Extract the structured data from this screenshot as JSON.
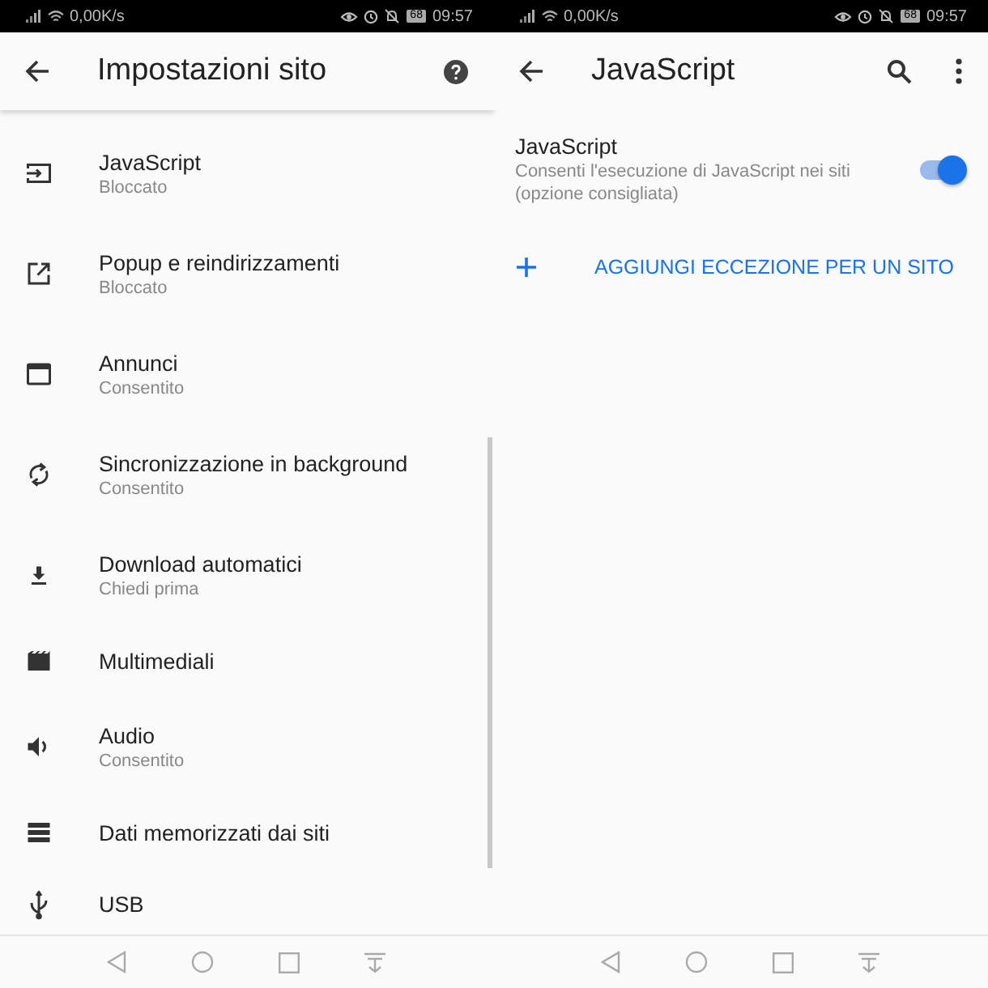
{
  "status_bars": [
    {
      "speed": "0,00K/s",
      "battery": "68",
      "time": "09:57"
    },
    {
      "speed": "0,00K/s",
      "battery": "68",
      "time": "09:57"
    }
  ],
  "site_settings": {
    "title": "Impostazioni sito",
    "items": [
      {
        "kind": "javascript",
        "title": "JavaScript",
        "subtitle": "Bloccato"
      },
      {
        "kind": "popup",
        "title": "Popup e reindirizzamenti",
        "subtitle": "Bloccato"
      },
      {
        "kind": "ads",
        "title": "Annunci",
        "subtitle": "Consentito"
      },
      {
        "kind": "sync",
        "title": "Sincronizzazione in background",
        "subtitle": "Consentito"
      },
      {
        "kind": "download",
        "title": "Download automatici",
        "subtitle": "Chiedi prima"
      },
      {
        "kind": "media",
        "title": "Multimediali"
      },
      {
        "kind": "sound",
        "title": "Audio",
        "subtitle": "Consentito"
      },
      {
        "kind": "storage",
        "title": "Dati memorizzati dai siti"
      },
      {
        "kind": "usb",
        "title": "USB"
      }
    ]
  },
  "javascript": {
    "title": "JavaScript",
    "setting": {
      "title": "JavaScript",
      "description": "Consenti l'esecuzione di JavaScript nei siti (opzione consigliata)",
      "on": true
    },
    "add_exception": "AGGIUNGI ECCEZIONE PER UN SITO"
  }
}
